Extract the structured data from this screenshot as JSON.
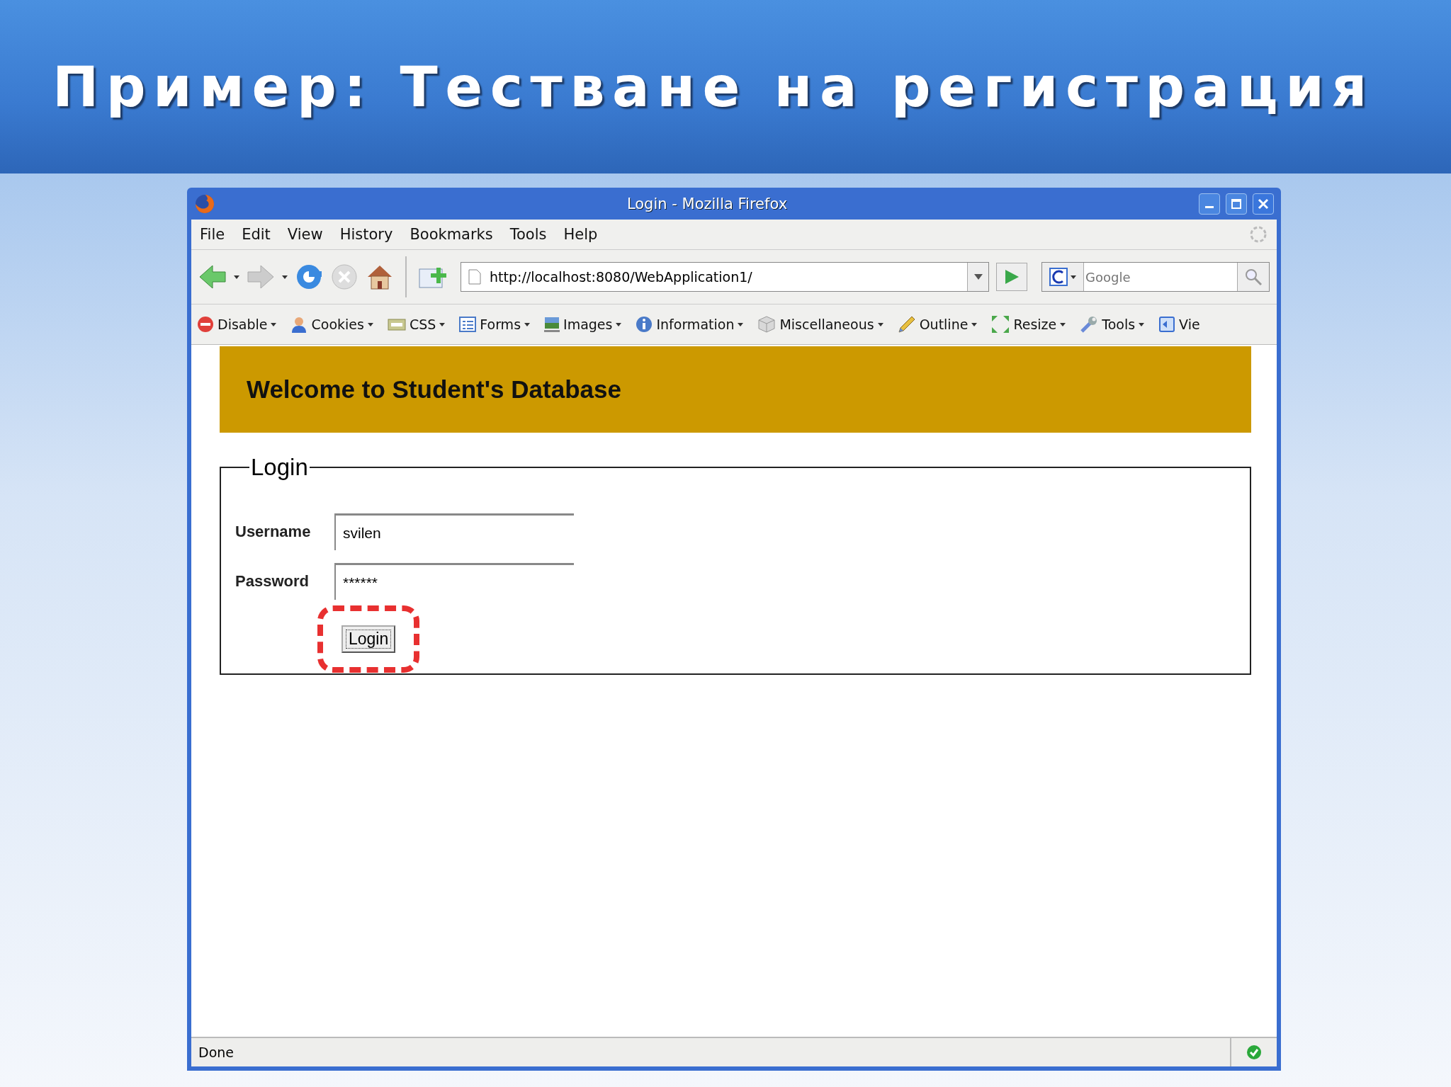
{
  "slide": {
    "title": "Пример: Тестване на регистрация"
  },
  "window": {
    "title": "Login - Mozilla Firefox"
  },
  "menu": [
    "File",
    "Edit",
    "View",
    "History",
    "Bookmarks",
    "Tools",
    "Help"
  ],
  "address": {
    "value": "http://localhost:8080/WebApplication1/"
  },
  "search": {
    "placeholder": "Google"
  },
  "dev_toolbar": [
    {
      "label": "Disable",
      "kind": "disable"
    },
    {
      "label": "Cookies",
      "kind": "cookies"
    },
    {
      "label": "CSS",
      "kind": "css"
    },
    {
      "label": "Forms",
      "kind": "forms"
    },
    {
      "label": "Images",
      "kind": "images"
    },
    {
      "label": "Information",
      "kind": "information"
    },
    {
      "label": "Miscellaneous",
      "kind": "miscellaneous"
    },
    {
      "label": "Outline",
      "kind": "outline"
    },
    {
      "label": "Resize",
      "kind": "resize"
    },
    {
      "label": "Tools",
      "kind": "tools"
    },
    {
      "label": "Vie",
      "kind": "view"
    }
  ],
  "page": {
    "banner": "Welcome to Student's Database",
    "legend": "Login",
    "fields": [
      {
        "label": "Username",
        "value": "svilen"
      },
      {
        "label": "Password",
        "value": "******"
      }
    ],
    "button": {
      "label": "Login",
      "highlighted": true
    }
  },
  "status_bar": {
    "text": "Done"
  }
}
